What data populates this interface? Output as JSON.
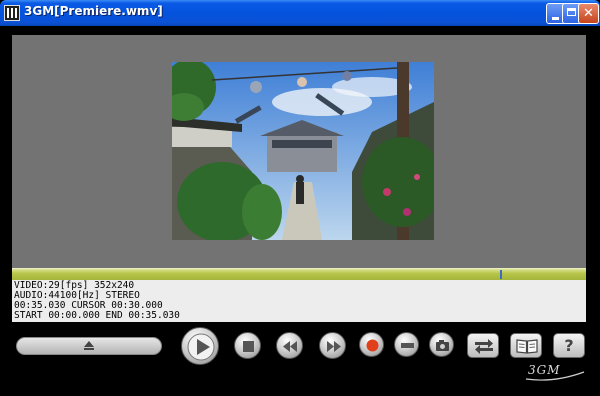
{
  "window": {
    "title": "3GM[Premiere.wmv]",
    "close_glyph": "✕"
  },
  "info": {
    "video": "VIDEO:29[fps] 352x240",
    "audio": "AUDIO:44100[Hz] STEREO",
    "time": "00:35.030 CURSOR 00:30.000",
    "range": "START 00:00.000 END 00:35.030"
  },
  "seek": {
    "position": 0.85
  },
  "controls": {
    "help_label": "?",
    "logo_text": "3GM"
  },
  "colors": {
    "titlebar": "#0453dd",
    "stage": "#737373",
    "seekbar": "#b7c54a",
    "record": "#e0401c"
  },
  "icons": [
    "app-icon",
    "minimize-icon",
    "maximize-icon",
    "close-icon",
    "eject-icon",
    "play-icon",
    "stop-icon",
    "rewind-icon",
    "fast-forward-icon",
    "record-icon",
    "mark-icon",
    "snapshot-icon",
    "swap-icon",
    "book-icon",
    "help-icon"
  ]
}
